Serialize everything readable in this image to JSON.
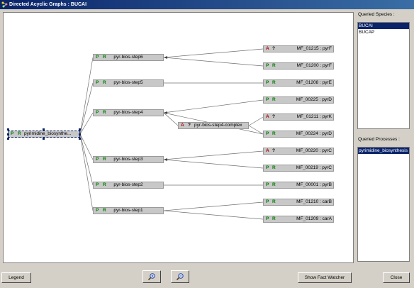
{
  "window": {
    "title": "Directed Acyclic Graphs : BUCAI"
  },
  "graph": {
    "root": {
      "flag1": "P",
      "flag2": "R",
      "label": "pyrimidine_biosynthe..."
    },
    "steps": [
      {
        "flag1": "P",
        "flag2": "R",
        "label": "pyr-bios-step6"
      },
      {
        "flag1": "P",
        "flag2": "R",
        "label": "pyr-bios-step5"
      },
      {
        "flag1": "P",
        "flag2": "R",
        "label": "pyr-bios-step4"
      },
      {
        "flag1": "P",
        "flag2": "R",
        "label": "pyr-bios-step3"
      },
      {
        "flag1": "P",
        "flag2": "R",
        "label": "pyr-bios-step2"
      },
      {
        "flag1": "P",
        "flag2": "R",
        "label": "pyr-bios-step1"
      }
    ],
    "complex": {
      "flag1": "A",
      "flag2": "?",
      "label": "pyr-bios-step4-complex"
    },
    "genes": [
      {
        "flag1": "A",
        "flag2": "?",
        "label": "MF_01215 : pyrF",
        "color1": "#b00000",
        "color2": "#000000"
      },
      {
        "flag1": "P",
        "flag2": "R",
        "label": "MF_01200 : pyrF",
        "color1": "#008000",
        "color2": "#008000"
      },
      {
        "flag1": "P",
        "flag2": "R",
        "label": "MF_01208 : pyrE",
        "color1": "#008000",
        "color2": "#008000"
      },
      {
        "flag1": "P",
        "flag2": "R",
        "label": "MF_00225 : pyrD",
        "color1": "#008000",
        "color2": "#008000"
      },
      {
        "flag1": "A",
        "flag2": "?",
        "label": "MF_01211 : pyrK",
        "color1": "#b00000",
        "color2": "#000000"
      },
      {
        "flag1": "P",
        "flag2": "R",
        "label": "MF_00224 : pyrD",
        "color1": "#008000",
        "color2": "#008000"
      },
      {
        "flag1": "A",
        "flag2": "?",
        "label": "MF_00220 : pyrC",
        "color1": "#b00000",
        "color2": "#000000"
      },
      {
        "flag1": "P",
        "flag2": "R",
        "label": "MF_00219 : pyrC",
        "color1": "#008000",
        "color2": "#008000"
      },
      {
        "flag1": "P",
        "flag2": "R",
        "label": "MF_00001 : pyrB",
        "color1": "#008000",
        "color2": "#008000"
      },
      {
        "flag1": "P",
        "flag2": "R",
        "label": "MF_01210 : carB",
        "color1": "#008000",
        "color2": "#008000"
      },
      {
        "flag1": "P",
        "flag2": "R",
        "label": "MF_01209 : carA",
        "color1": "#008000",
        "color2": "#008000"
      }
    ]
  },
  "species_panel": {
    "label": "Queried Species :",
    "items": [
      "BUCAI",
      "BUCAP"
    ],
    "selected": "BUCAI"
  },
  "processes_panel": {
    "label": "Queried Processes :",
    "items": [
      "pyrimidine_biosynthesis"
    ],
    "selected": "pyrimidine_biosynthesis"
  },
  "buttons": {
    "legend": "Legend",
    "zoom_in_icon": "magnifier-plus-icon",
    "zoom_out_icon": "magnifier-minus-icon",
    "fact_watcher": "Show Fact Watcher",
    "close": "Close"
  },
  "colors": {
    "title_bar": "#0a246a",
    "selection": "#0a246a",
    "present": "#008000",
    "absent": "#b00000"
  }
}
